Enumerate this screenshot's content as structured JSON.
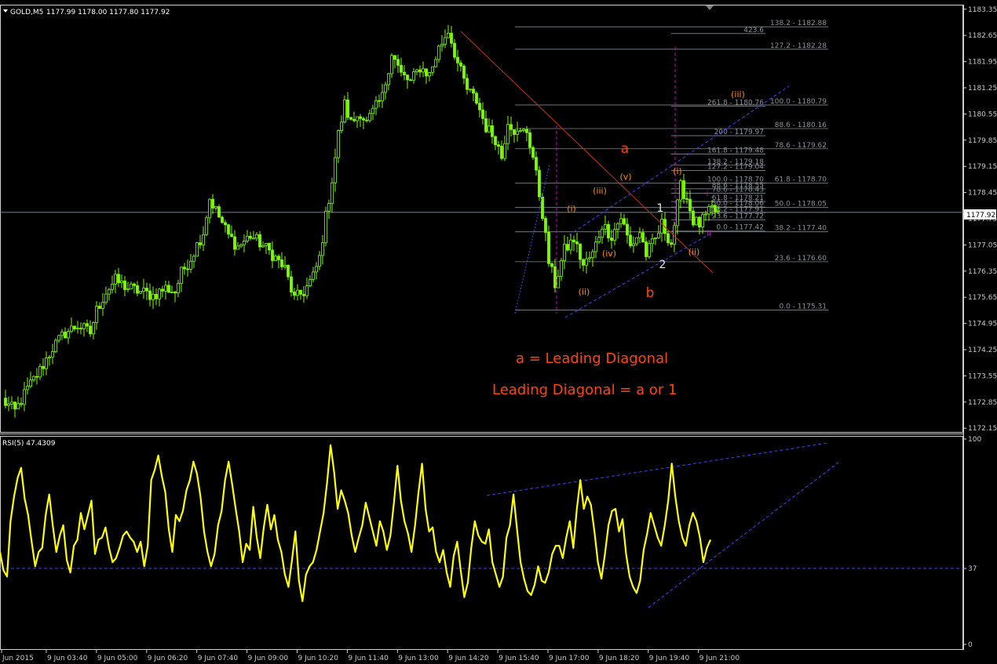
{
  "header": {
    "symbol": "GOLD,M5",
    "ohlc": "1177.99 1178.00 1177.80 1177.92"
  },
  "rsi_header": "RSI(5) 47.4309",
  "current_price_label": "1177.92",
  "colors": {
    "background": "#000000",
    "bull_candle": "#7CFC00",
    "bear_candle": "#ffffff",
    "rsi_line": "#ffff00",
    "trendline_blue": "#4040ff",
    "trendline_red": "#c83200",
    "annotation_orange": "#ff4500",
    "wave_label": "#ff8c00",
    "fib_line": "#808890",
    "magenta": "#cc00cc"
  },
  "annotations": {
    "line1": "a = Leading Diagonal",
    "line2": "Leading Diagonal = a or 1"
  },
  "wave_labels": [
    {
      "text": "a",
      "size": "big",
      "color": "#ff4500"
    },
    {
      "text": "b",
      "size": "big",
      "color": "#ff4500"
    },
    {
      "text": "(i)",
      "size": "small",
      "color": "#ff8c00"
    },
    {
      "text": "(ii)",
      "size": "small",
      "color": "#ff8c00"
    },
    {
      "text": "(iii)",
      "size": "small",
      "color": "#ff8c00"
    },
    {
      "text": "(iv)",
      "size": "small",
      "color": "#ff8c00"
    },
    {
      "text": "(v)",
      "size": "small",
      "color": "#ff8c00"
    },
    {
      "text": "(i)",
      "size": "small",
      "color": "#ff8c00"
    },
    {
      "text": "(ii)",
      "size": "small",
      "color": "#ff8c00"
    },
    {
      "text": "(iii)",
      "size": "small",
      "color": "#ff8c00"
    },
    {
      "text": "1",
      "size": "mid",
      "color": "#e8e8e8"
    },
    {
      "text": "2",
      "size": "mid",
      "color": "#e8e8e8"
    },
    {
      "text": "i",
      "size": "tiny",
      "color": "#cc00cc"
    },
    {
      "text": "ii",
      "size": "tiny",
      "color": "#cc00cc"
    }
  ],
  "fib_levels": [
    "423.6",
    "138.2 - 1182.88",
    "127.2 - 1182.28",
    "261.8 - 1180.76",
    "100.0 - 1180.79",
    "88.6 - 1180.16",
    "200 - 1179.97",
    "78.6 - 1179.62",
    "161.8 - 1179.48",
    "138.2 - 1179.18",
    "127.2 - 1179.04",
    "100.0 - 1178.70",
    "61.8 - 1178.70",
    "88.6 - 1178.55",
    "78.6 - 1178.43",
    "61.8 - 1178.21",
    "50.0 - 1178.06",
    "50.0 - 1178.05",
    "38.2 - 1177.91",
    "23.6 - 1177.72",
    "0.0 - 1177.42",
    "38.2 - 1177.40",
    "23.6 - 1176.60",
    "0.0 - 1175.31"
  ],
  "chart_data": [
    {
      "type": "candlestick",
      "title": "GOLD,M5",
      "xlabel": "",
      "ylabel": "",
      "ylim": [
        1172.05,
        1183.45
      ],
      "y_ticks": [
        "1183.35",
        "1182.65",
        "1181.95",
        "1181.25",
        "1180.55",
        "1179.85",
        "1179.15",
        "1178.45",
        "1177.75",
        "1177.05",
        "1176.35",
        "1175.65",
        "1174.95",
        "1174.25",
        "1173.55",
        "1172.85",
        "1172.15"
      ],
      "x_tick_labels": [
        "Jun 2015",
        "9 Jun 03:40",
        "9 Jun 05:00",
        "9 Jun 06:20",
        "9 Jun 07:40",
        "9 Jun 09:00",
        "9 Jun 10:20",
        "9 Jun 11:40",
        "9 Jun 13:00",
        "9 Jun 14:20",
        "9 Jun 15:40",
        "9 Jun 17:00",
        "9 Jun 18:20",
        "9 Jun 19:40",
        "9 Jun 21:00"
      ],
      "current_price": 1177.92,
      "close_trace": [
        [
          0,
          1172.9
        ],
        [
          4,
          1172.6
        ],
        [
          8,
          1173.2
        ],
        [
          12,
          1173.7
        ],
        [
          16,
          1174.3
        ],
        [
          20,
          1174.7
        ],
        [
          24,
          1174.9
        ],
        [
          28,
          1174.7
        ],
        [
          30,
          1175.3
        ],
        [
          33,
          1175.8
        ],
        [
          36,
          1176.1
        ],
        [
          40,
          1175.9
        ],
        [
          44,
          1175.8
        ],
        [
          48,
          1175.7
        ],
        [
          52,
          1175.9
        ],
        [
          55,
          1175.8
        ],
        [
          57,
          1176.3
        ],
        [
          60,
          1176.7
        ],
        [
          64,
          1177.4
        ],
        [
          66,
          1178.3
        ],
        [
          69,
          1177.8
        ],
        [
          72,
          1177.3
        ],
        [
          75,
          1177.0
        ],
        [
          79,
          1177.3
        ],
        [
          82,
          1177.1
        ],
        [
          86,
          1176.8
        ],
        [
          90,
          1176.4
        ],
        [
          93,
          1175.6
        ],
        [
          96,
          1175.8
        ],
        [
          99,
          1176.2
        ],
        [
          101,
          1176.7
        ],
        [
          103,
          1177.8
        ],
        [
          105,
          1178.8
        ],
        [
          107,
          1180.0
        ],
        [
          109,
          1180.8
        ],
        [
          111,
          1180.3
        ],
        [
          114,
          1180.6
        ],
        [
          116,
          1180.3
        ],
        [
          118,
          1180.6
        ],
        [
          121,
          1181.0
        ],
        [
          124,
          1182.2
        ],
        [
          127,
          1181.6
        ],
        [
          130,
          1181.4
        ],
        [
          133,
          1181.8
        ],
        [
          136,
          1181.6
        ],
        [
          139,
          1182.3
        ],
        [
          142,
          1182.8
        ],
        [
          145,
          1181.9
        ],
        [
          148,
          1181.2
        ],
        [
          151,
          1180.9
        ],
        [
          154,
          1180.2
        ],
        [
          157,
          1179.9
        ],
        [
          159,
          1179.4
        ],
        [
          161,
          1180.4
        ],
        [
          164,
          1180.0
        ],
        [
          167,
          1180.1
        ],
        [
          169,
          1179.4
        ],
        [
          172,
          1177.9
        ],
        [
          174,
          1176.6
        ],
        [
          176,
          1176.0
        ],
        [
          179,
          1176.9
        ],
        [
          182,
          1177.2
        ],
        [
          185,
          1176.5
        ],
        [
          188,
          1176.8
        ],
        [
          191,
          1177.6
        ],
        [
          194,
          1177.3
        ],
        [
          197,
          1177.8
        ],
        [
          200,
          1177.0
        ],
        [
          203,
          1177.4
        ],
        [
          205,
          1176.8
        ],
        [
          208,
          1177.2
        ],
        [
          210,
          1177.6
        ],
        [
          213,
          1177.1
        ],
        [
          216,
          1178.6
        ],
        [
          218,
          1178.3
        ],
        [
          220,
          1177.7
        ],
        [
          222,
          1177.6
        ],
        [
          224,
          1177.8
        ],
        [
          226,
          1178.0
        ],
        [
          228,
          1177.9
        ]
      ]
    },
    {
      "type": "line",
      "title": "RSI(5) 47.4309",
      "xlabel": "",
      "ylabel": "",
      "ylim": [
        0,
        100
      ],
      "y_ticks": [
        "100",
        "37",
        "0"
      ],
      "level_line": 37,
      "series": [
        {
          "name": "RSI(5)",
          "values": [
            45,
            36,
            33,
            60,
            72,
            81,
            86,
            71,
            63,
            50,
            38,
            45,
            47,
            63,
            73,
            58,
            45,
            53,
            58,
            41,
            35,
            48,
            51,
            64,
            56,
            63,
            70,
            44,
            51,
            52,
            57,
            47,
            40,
            42,
            47,
            53,
            55,
            52,
            50,
            45,
            50,
            38,
            48,
            80,
            85,
            92,
            82,
            74,
            56,
            45,
            63,
            60,
            65,
            75,
            80,
            89,
            83,
            72,
            55,
            45,
            38,
            44,
            58,
            65,
            80,
            89,
            78,
            66,
            55,
            40,
            49,
            46,
            67,
            52,
            42,
            57,
            68,
            56,
            63,
            51,
            45,
            34,
            28,
            41,
            55,
            31,
            21,
            34,
            38,
            40,
            46,
            55,
            64,
            79,
            97,
            84,
            66,
            75,
            70,
            64,
            53,
            45,
            52,
            58,
            69,
            62,
            55,
            48,
            60,
            55,
            46,
            53,
            69,
            87,
            70,
            60,
            54,
            45,
            58,
            74,
            88,
            66,
            55,
            57,
            45,
            40,
            46,
            35,
            28,
            43,
            50,
            36,
            23,
            30,
            47,
            60,
            53,
            50,
            49,
            56,
            40,
            34,
            28,
            33,
            52,
            58,
            73,
            56,
            40,
            32,
            26,
            24,
            29,
            38,
            31,
            30,
            35,
            44,
            48,
            48,
            42,
            52,
            60,
            47,
            66,
            80,
            66,
            72,
            68,
            55,
            40,
            32,
            44,
            58,
            65,
            66,
            55,
            61,
            44,
            33,
            28,
            25,
            31,
            46,
            54,
            64,
            58,
            52,
            48,
            58,
            70,
            88,
            72,
            60,
            52,
            48,
            58,
            64,
            60,
            52,
            40,
            47,
            51
          ]
        }
      ]
    }
  ]
}
